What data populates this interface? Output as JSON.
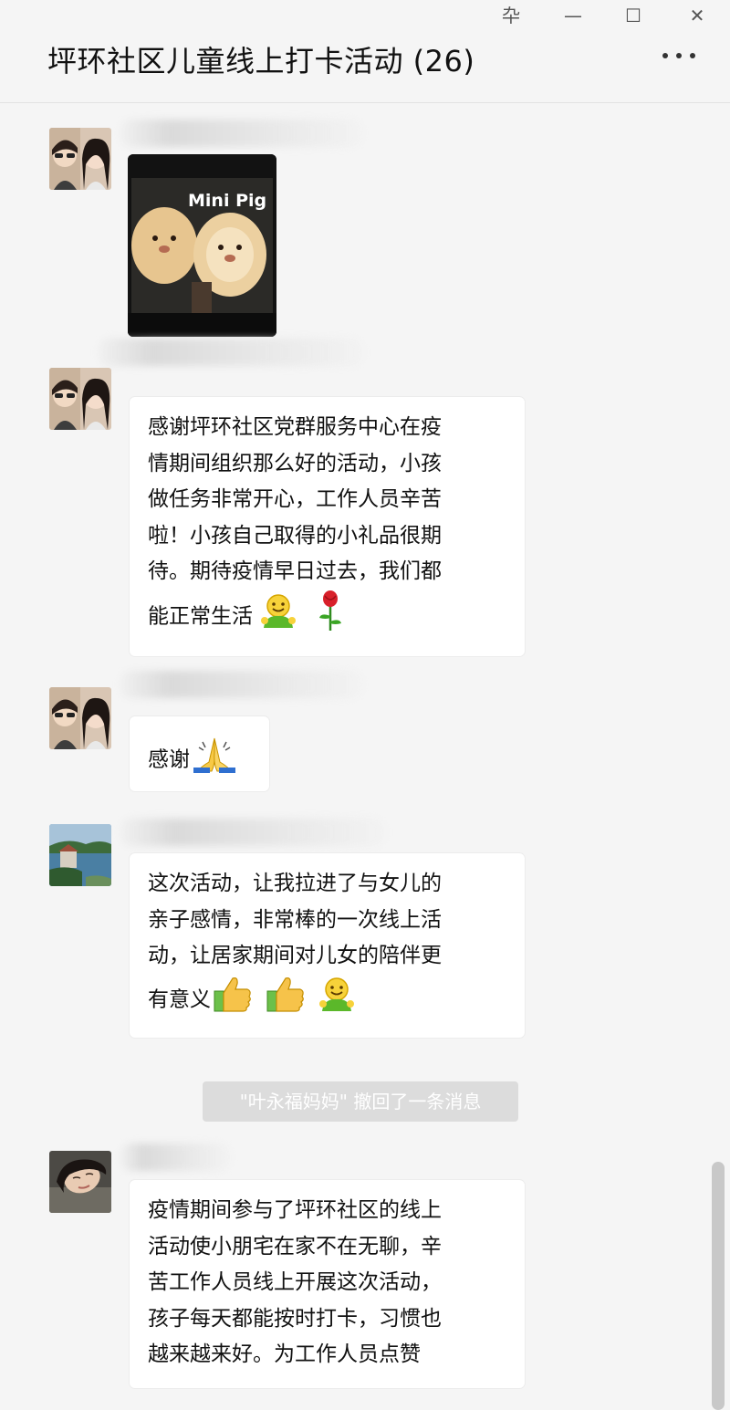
{
  "window": {
    "pin_glyph": "卆",
    "minimize_glyph": "—",
    "maximize_glyph": "☐",
    "close_glyph": "✕",
    "title": "坪环社区儿童线上打卡活动 (26)"
  },
  "photo": {
    "caption": "Mini Pig"
  },
  "messages": [
    {
      "text": "感谢坪环社区党群服务中心在疫\n情期间组织那么好的活动，小孩\n做任务非常开心，工作人员辛苦\n啦！小孩自己取得的小礼品很期\n待。期待疫情早日过去，我们都\n能正常生活",
      "emojis": [
        "smile-emoji",
        "rose-emoji"
      ]
    },
    {
      "text": "感谢",
      "emojis": [
        "pray-emoji"
      ]
    },
    {
      "text": "这次活动，让我拉进了与女儿的\n亲子感情，非常棒的一次线上活\n动，让居家期间对儿女的陪伴更\n有意义",
      "emojis": [
        "thumbs-up-emoji",
        "thumbs-up-emoji",
        "smile-emoji"
      ]
    },
    {
      "text": "疫情期间参与了坪环社区的线上\n活动使小朋宅在家不在无聊，辛\n苦工作人员线上开展这次活动，\n孩子每天都能按时打卡，习惯也\n越来越来好。为工作人员点赞",
      "emojis": []
    }
  ],
  "recall_notice": "\"叶永福妈妈\" 撤回了一条消息",
  "colors": {
    "background": "#f5f5f5",
    "bubble": "#ffffff",
    "recall_bg": "#dcdcdc"
  }
}
